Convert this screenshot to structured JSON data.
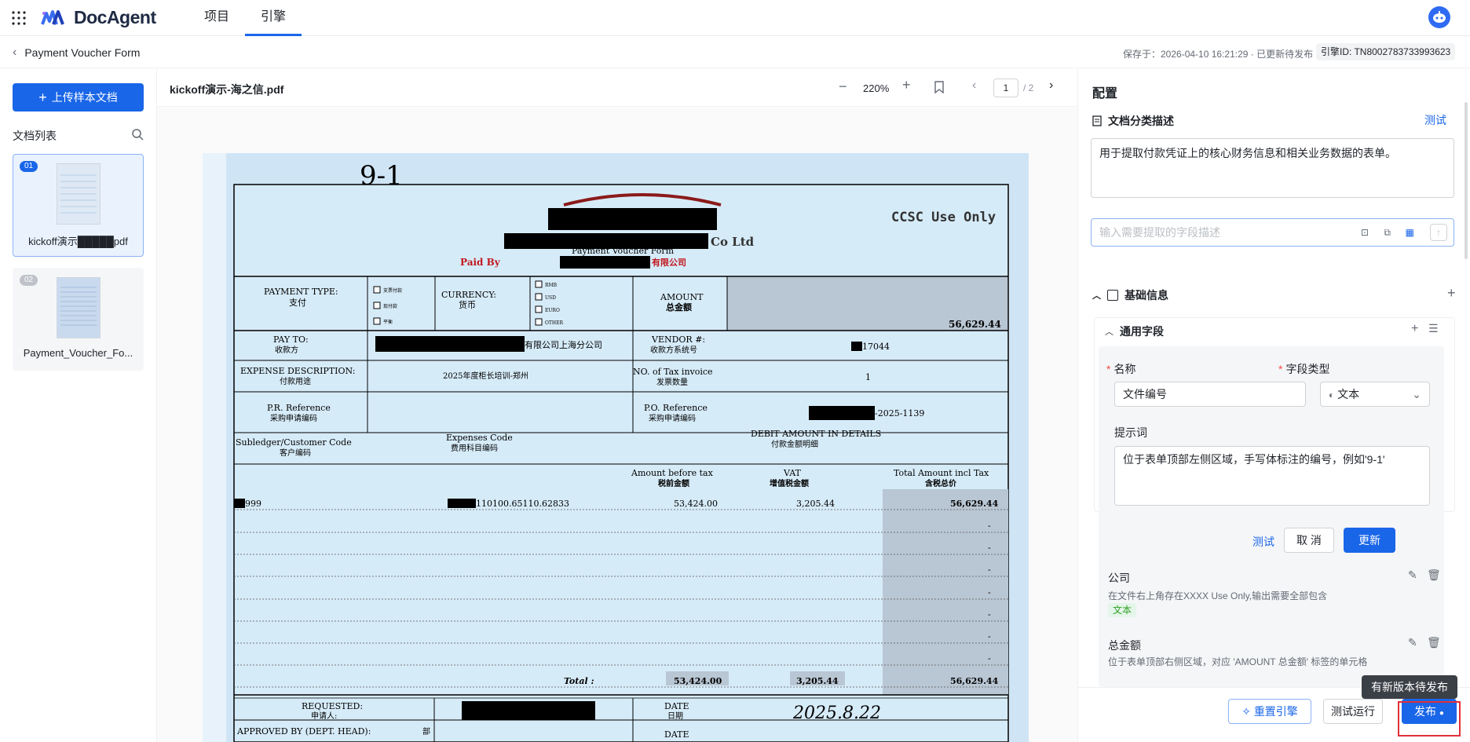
{
  "app": {
    "brand": "DocAgent",
    "nav_tabs": [
      "项目",
      "引擎"
    ],
    "active_tab": "引擎"
  },
  "colors": {
    "accent": "#1a66e8",
    "danger": "#e0303a",
    "success": "#2ea121"
  },
  "subbar": {
    "back_title": "Payment Voucher Form",
    "save_status": "保存于：2026-04-10 16:21:29 · 已更新待发布",
    "engine_id": "引擎ID: TN8002783733993623"
  },
  "left": {
    "upload_label": "上传样本文档",
    "doclist_title": "文档列表",
    "docs": [
      {
        "idx": "01",
        "name": "kickoff演示█████pdf"
      },
      {
        "idx": "02",
        "name": "Payment_Voucher_Fo..."
      }
    ]
  },
  "viewer": {
    "file_name": "kickoff演示-海之信.pdf",
    "zoom": "220%",
    "page": "1",
    "total": "/ 2",
    "doc": {
      "handwritten_no": "9-1",
      "ccsc": "CCSC Use Only",
      "co_ltd": "Co Ltd",
      "form_title": "Payment Voucher Form",
      "paid_by": "Paid By",
      "company_suffix": "有限公司",
      "payment_type": "PAYMENT TYPE:",
      "payment_type_cn": "支付",
      "pay_opts": [
        "支票付款",
        "现付款",
        "平衡"
      ],
      "currency": "CURRENCY:",
      "currency_cn": "货币",
      "cur_opts": [
        "RMB",
        "USD",
        "EURO",
        "OTHER"
      ],
      "amount": "AMOUNT",
      "amount_cn": "总金额",
      "amount_val": "56,629.44",
      "pay_to": "PAY TO:",
      "pay_to_cn": "收款方",
      "pay_to_val": "有限公司上海分公司",
      "vendor": "VENDOR #:",
      "vendor_cn": "收款方系统号",
      "vendor_val": "17044",
      "exp_desc": "EXPENSE DESCRIPTION:",
      "exp_desc_cn": "付款用途",
      "exp_desc_val": "2025年度柜长培训-郑州",
      "tax_inv": "NO. of Tax invoice",
      "tax_inv_cn": "发票数量",
      "tax_inv_val": "1",
      "pr_ref": "P.R. Reference",
      "pr_ref_cn": "采购申请编码",
      "po_ref": "P.O. Reference",
      "po_ref_cn": "采购申请编码",
      "po_ref_val": "-2025-1139",
      "subledger": "Subledger/Customer Code",
      "subledger_cn": "客户编码",
      "exp_code": "Expenses Code",
      "exp_code_cn": "费用科目编码",
      "debit": "DEBIT AMOUNT IN DETAILS",
      "debit_cn": "付款金额明细",
      "amt_bt": "Amount before tax",
      "amt_bt_cn": "税前金额",
      "vat": "VAT",
      "vat_cn": "增值税金额",
      "total_incl": "Total Amount incl Tax",
      "total_incl_cn": "含税总价",
      "row_sub": "999",
      "row_code": "110100.65110.62833",
      "row_amt": "53,424.00",
      "row_vat": "3,205.44",
      "row_total": "56,629.44",
      "dash": "-",
      "total_label": "Total :",
      "total_amt": "53,424.00",
      "total_vat": "3,205.44",
      "total_total": "56,629.44",
      "requested": "REQUESTED:",
      "requested_cn": "申请人:",
      "date": "DATE",
      "date_cn": "日期",
      "date_val": "2025.8.22",
      "approved": "APPROVED BY (DEPT. HEAD):",
      "approved_mark": "部",
      "date2": "DATE"
    }
  },
  "right": {
    "title": "配置",
    "classify": {
      "title": "文档分类描述",
      "test": "测试",
      "desc": "用于提取付款凭证上的核心财务信息和相关业务数据的表单。"
    },
    "field_placeholder": "输入需要提取的字段描述",
    "basic": {
      "title": "基础信息"
    },
    "general": {
      "title": "通用字段"
    },
    "form": {
      "name_label": "名称",
      "name_value": "文件编号",
      "type_label": "字段类型",
      "type_value": "文本",
      "prompt_label": "提示词",
      "prompt_value": "位于表单顶部左侧区域，手写体标注的编号，例如'9-1'",
      "test": "测试",
      "cancel": "取 消",
      "update": "更新"
    },
    "items": [
      {
        "name": "公司",
        "desc": "在文件右上角存在XXXX Use Only,输出需要全部包含",
        "tag": "文本"
      },
      {
        "name": "总金额",
        "desc": "位于表单顶部右侧区域，对应 'AMOUNT 总金额' 标签的单元格"
      }
    ],
    "footer": {
      "reset": "重置引擎",
      "test_run": "测试运行",
      "publish": "发布"
    },
    "tooltip": "有新版本待发布"
  }
}
